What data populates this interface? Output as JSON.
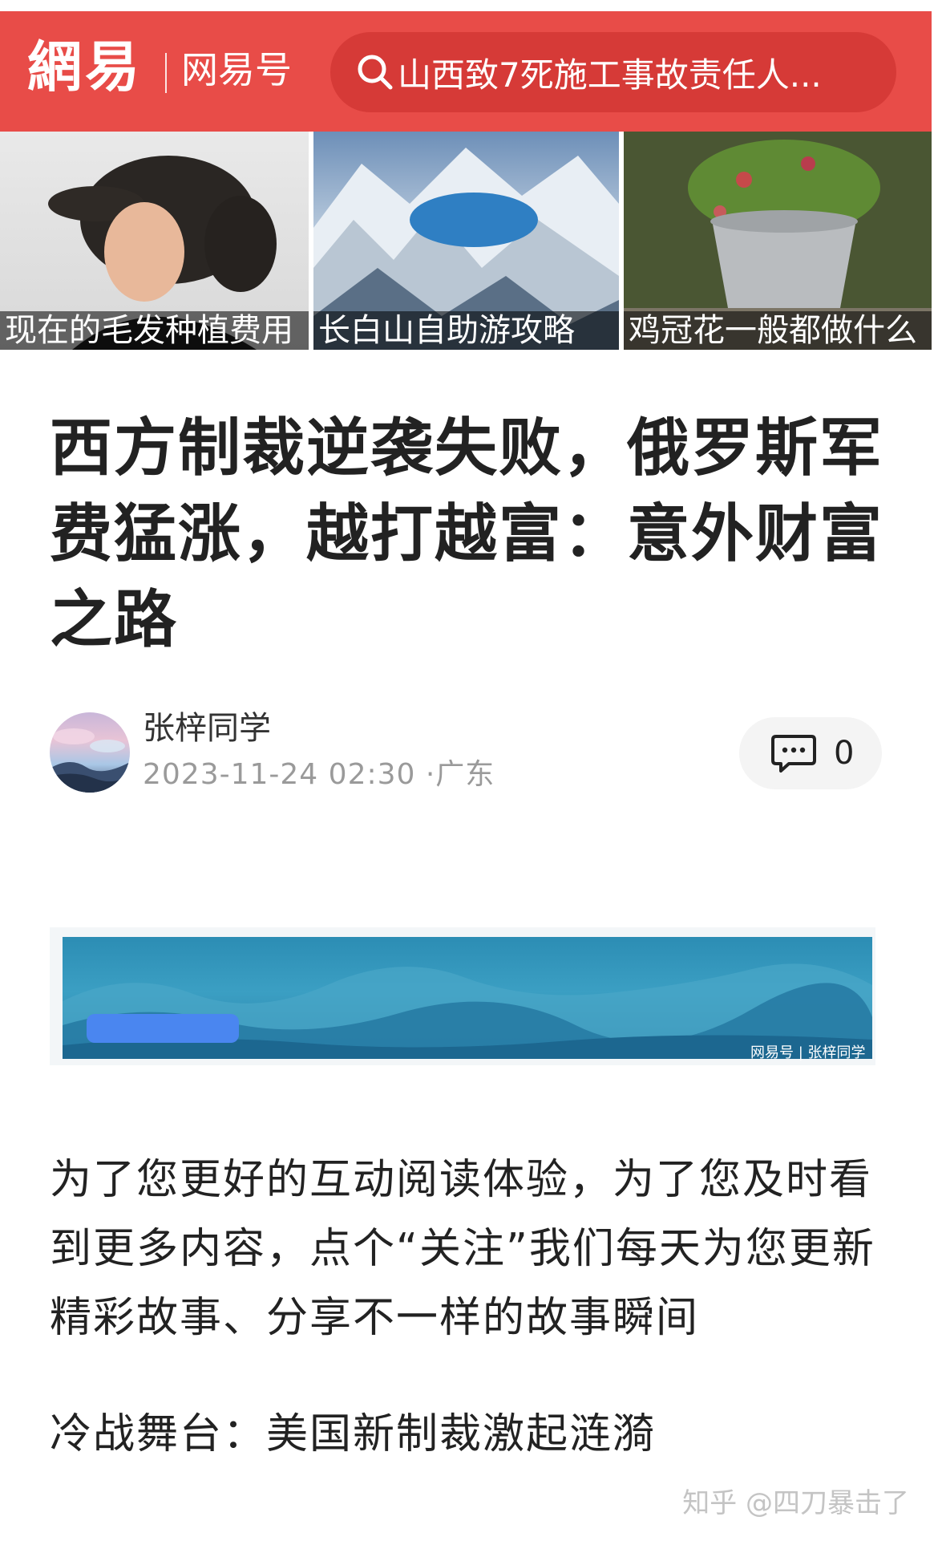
{
  "header": {
    "logo": "網易",
    "subbrand": "网易号",
    "search_text": "山西致7死施工事故责任人...",
    "brand_color": "#e84c48"
  },
  "recommended": [
    {
      "caption": "现在的毛发种植费用"
    },
    {
      "caption": "长白山自助游攻略"
    },
    {
      "caption": "鸡冠花一般都做什么"
    }
  ],
  "article": {
    "title": "西方制裁逆袭失败，俄罗斯军费猛涨，越打越富：意外财富之路",
    "author": "张梓同学",
    "meta": "2023-11-24 02:30 ·广东",
    "comment_count": "0",
    "banner_watermark": "网易号 | 张梓同学",
    "paragraph_1": "为了您更好的互动阅读体验，为了您及时看到更多内容，点个“关注”我们每天为您更新精彩故事、分享不一样的故事瞬间",
    "paragraph_2": "冷战舞台：美国新制裁激起涟漪"
  },
  "watermark": "知乎 @四刀暴击了"
}
